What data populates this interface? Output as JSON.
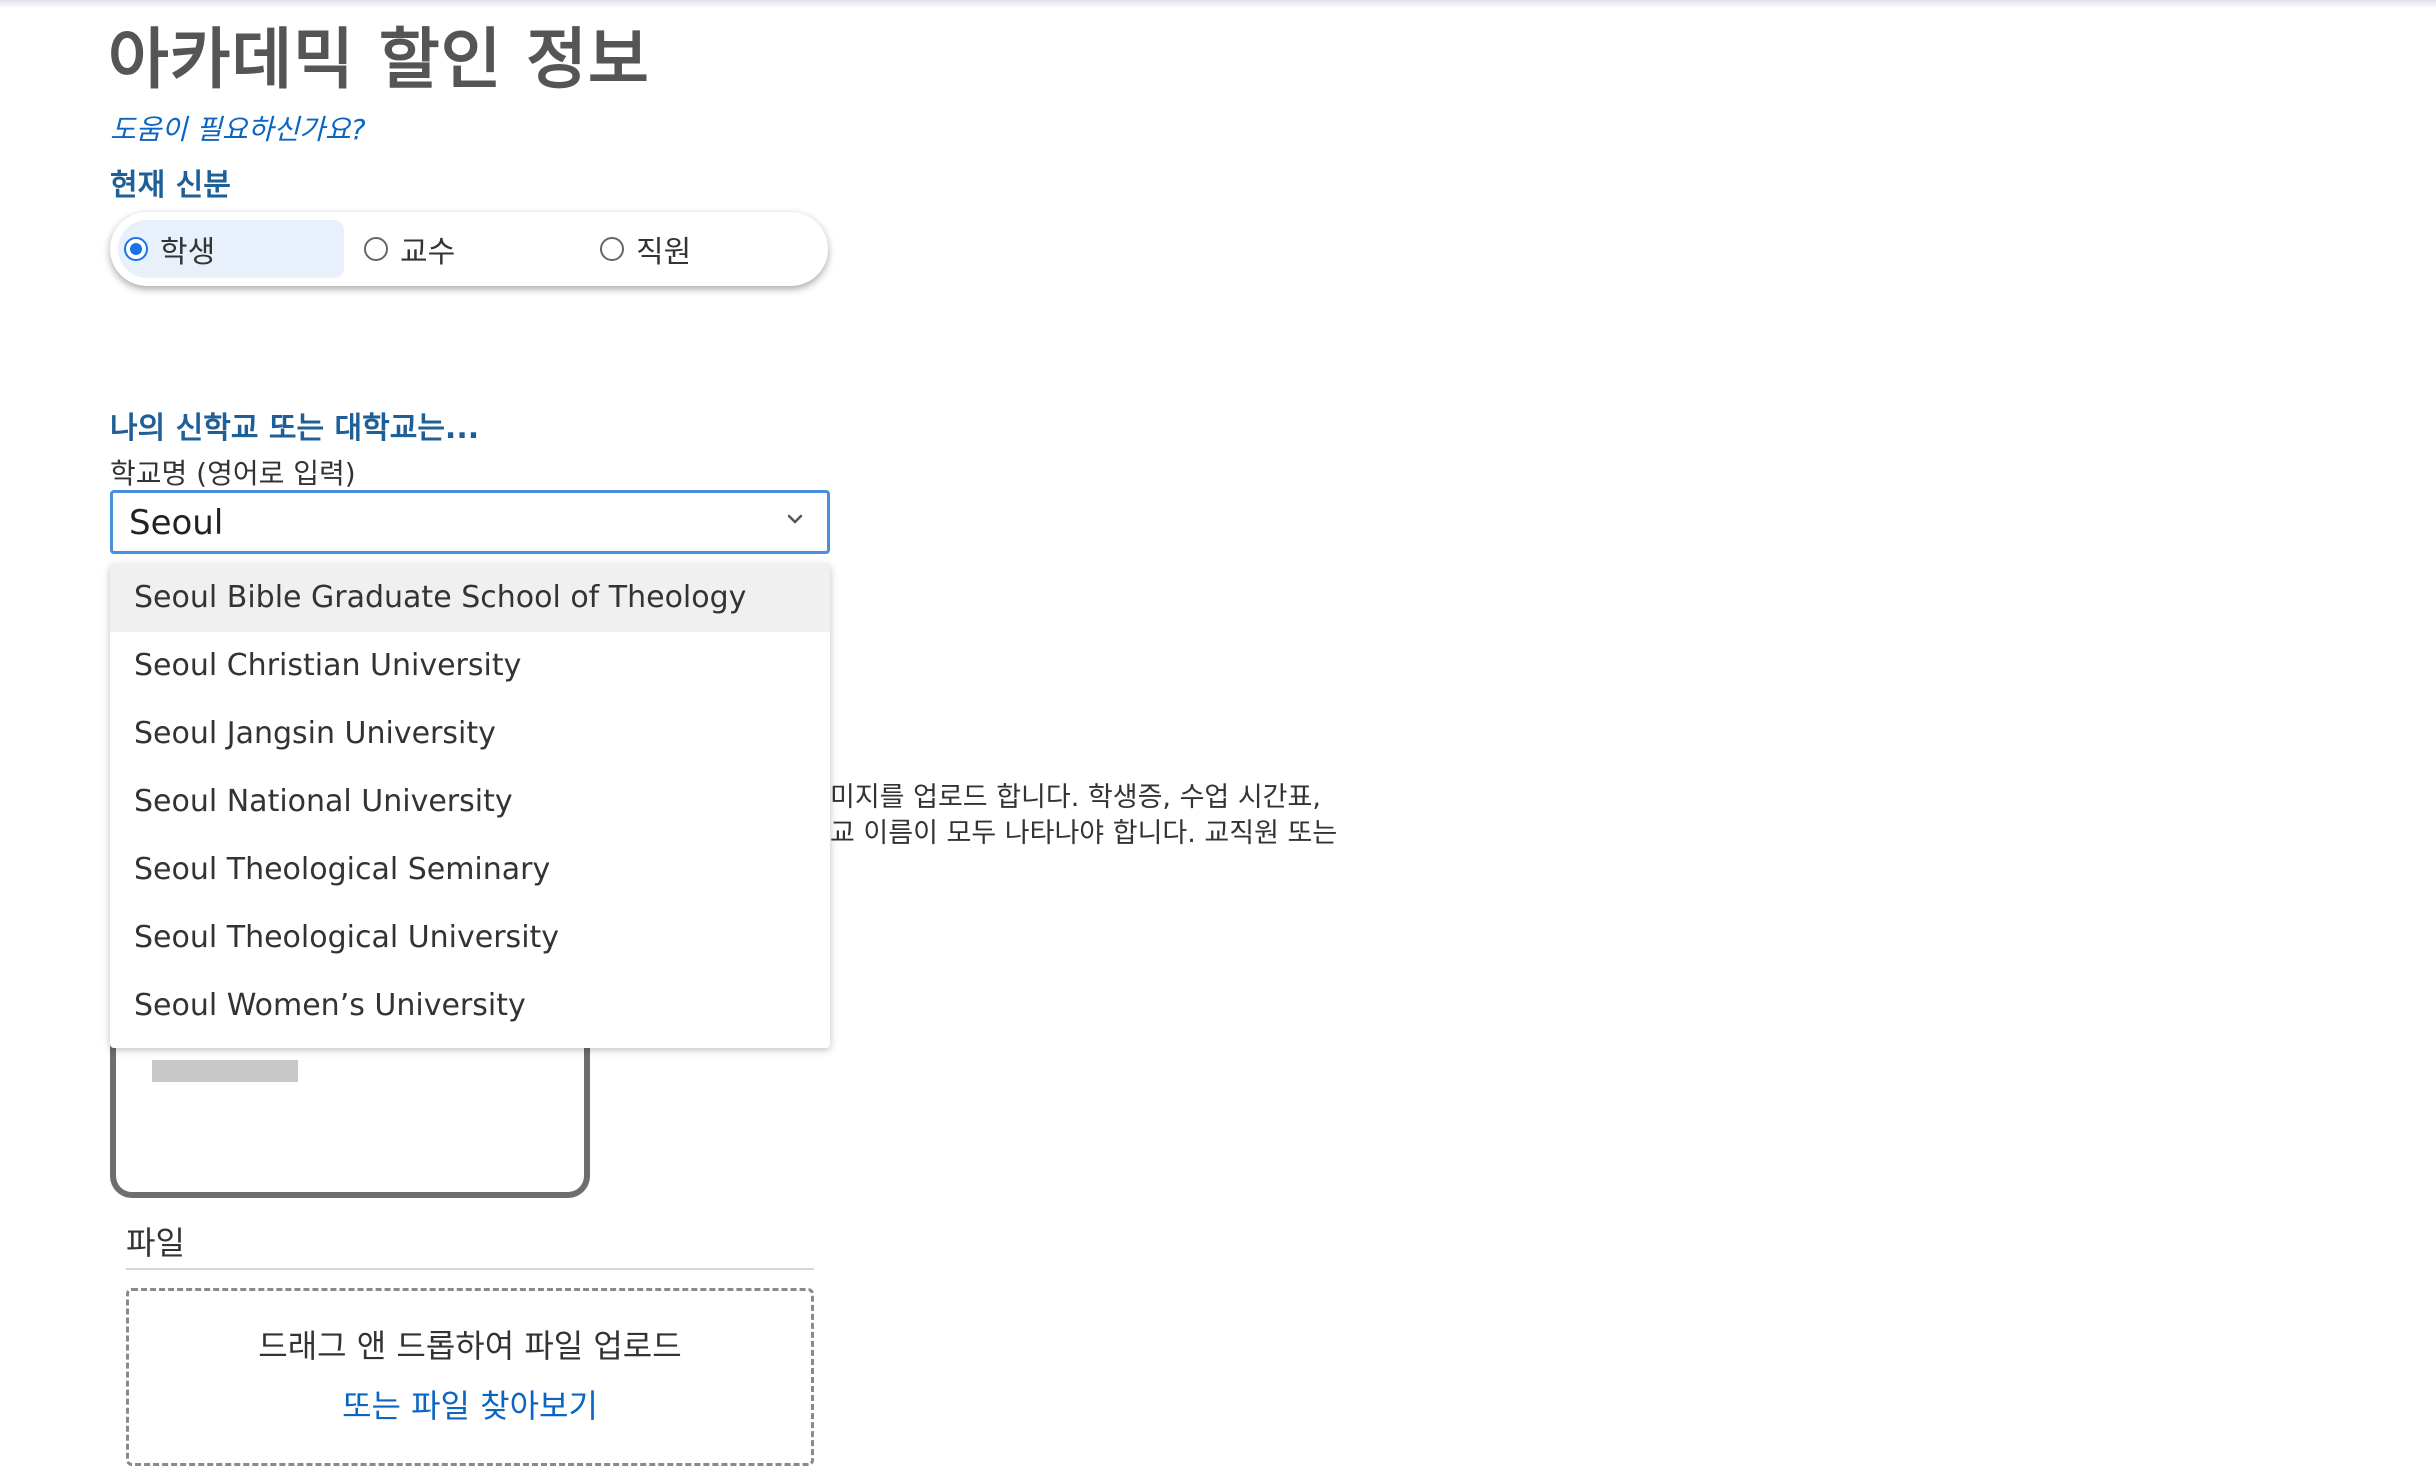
{
  "header": {
    "title": "아카데믹 할인 정보",
    "help_link": "도움이 필요하신가요?"
  },
  "status": {
    "label": "현재 신분",
    "options": [
      {
        "label": "학생",
        "selected": true
      },
      {
        "label": "교수",
        "selected": false
      },
      {
        "label": "직원",
        "selected": false
      }
    ]
  },
  "school": {
    "section_label": "나의 신학교 또는 대학교는...",
    "field_label": "학교명 (영어로 입력)",
    "input_value": "Seoul",
    "suggestions": [
      "Seoul Bible Graduate School of Theology",
      "Seoul Christian University",
      "Seoul Jangsin University",
      "Seoul National University",
      "Seoul Theological Seminary",
      "Seoul Theological University",
      "Seoul Women’s University"
    ],
    "highlighted_index": 0
  },
  "upload": {
    "description_line1": "미지를 업로드 합니다. 학생증, 수업 시간표,",
    "description_line2": "교 이름이 모두 나타나야 합니다. 교직원 또는",
    "file_label": "파일",
    "dropzone_text": "드래그 앤 드롭하여 파일 업로드",
    "browse_link": "또는 파일 찾아보기"
  },
  "colors": {
    "accent": "#1a73e8",
    "heading_blue": "#1f5f97",
    "link_blue": "#0b66c3",
    "title_gray": "#555555"
  }
}
